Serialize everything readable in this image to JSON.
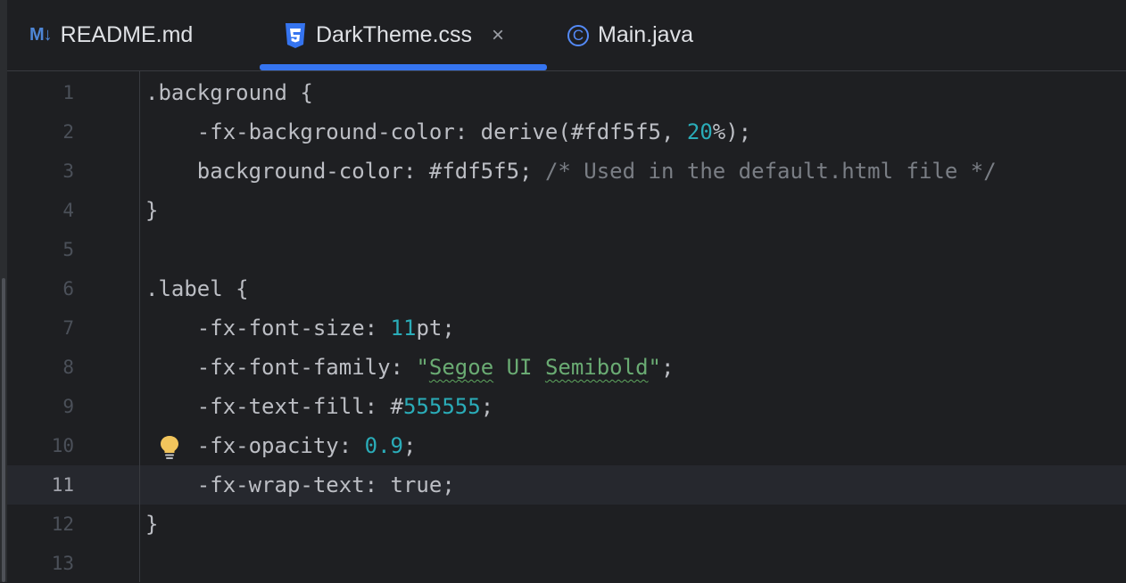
{
  "tabs": [
    {
      "icon": "M↓",
      "label": "README.md"
    },
    {
      "icon": "css-file-icon",
      "label": "DarkTheme.css",
      "close": "×",
      "active": true
    },
    {
      "icon": "©",
      "label": "Main.java"
    }
  ],
  "editor": {
    "current_line": 11,
    "lines": [
      {
        "n": "1"
      },
      {
        "n": "2"
      },
      {
        "n": "3"
      },
      {
        "n": "4"
      },
      {
        "n": "5"
      },
      {
        "n": "6"
      },
      {
        "n": "7"
      },
      {
        "n": "8"
      },
      {
        "n": "9"
      },
      {
        "n": "10"
      },
      {
        "n": "11"
      },
      {
        "n": "12"
      },
      {
        "n": "13"
      }
    ],
    "code": {
      "l1": ".background {",
      "l2a": "    -fx-background-color: derive(#fdf5f5, ",
      "l2b": "20",
      "l2c": "%);",
      "l3a": "    background-color: #fdf5f5; ",
      "l3b": "/* Used in the default.html file */",
      "l4": "}",
      "l5": "",
      "l6": ".label {",
      "l7a": "    -fx-font-size: ",
      "l7b": "11",
      "l7c": "pt;",
      "l8a": "    -fx-font-family: ",
      "l8b": "\"",
      "l8c": "Segoe",
      "l8d": " UI ",
      "l8e": "Semibold",
      "l8f": "\"",
      "l8g": ";",
      "l9a": "    -fx-text-fill: #",
      "l9b": "555555",
      "l9c": ";",
      "l10a": "    -fx-opacity: ",
      "l10b": "0.9",
      "l10c": ";",
      "l11": "    -fx-wrap-text: true;",
      "l12": "}",
      "l13": ""
    }
  },
  "colors": {
    "background": "#1e1f22",
    "accent": "#3574f0",
    "number": "#2aacb8",
    "string": "#6aab73",
    "comment": "#7a7e85",
    "text": "#bcbec4"
  }
}
